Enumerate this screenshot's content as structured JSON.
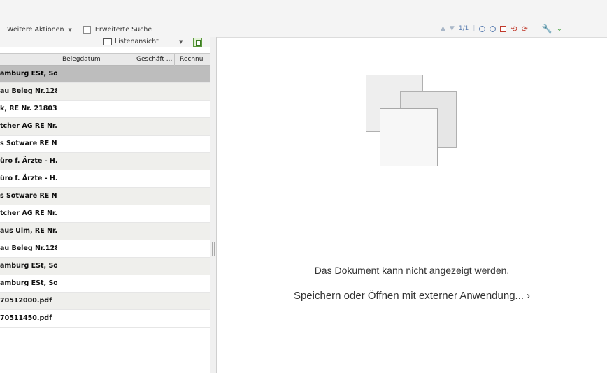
{
  "toolbar": {
    "more_actions_label": "Weitere Aktionen",
    "more_actions_icon": "chevron-down",
    "advanced_search_label": "Erweiterte Suche",
    "advanced_search_checked": false
  },
  "list_toolbar": {
    "view_label": "Listenansicht",
    "view_icon": "grid-list",
    "export_icon": "excel-export"
  },
  "table": {
    "columns": [
      "Belegdatum",
      "Geschäft ...",
      "Rechnu"
    ],
    "rows": [
      {
        "label": "amburg ESt, Soll",
        "state": "selected"
      },
      {
        "label": "au Beleg Nr.128",
        "state": "alt"
      },
      {
        "label": "k, RE Nr. 21803",
        "state": ""
      },
      {
        "label": "tcher AG RE Nr.",
        "state": "alt"
      },
      {
        "label": "s Sotware RE Nr",
        "state": ""
      },
      {
        "label": "üro f. Ärzte - H.",
        "state": "alt"
      },
      {
        "label": "üro f. Ärzte - H.",
        "state": ""
      },
      {
        "label": "s Sotware RE Nr",
        "state": "alt"
      },
      {
        "label": "tcher AG RE Nr.",
        "state": ""
      },
      {
        "label": "aus Ulm, RE Nr.",
        "state": "alt"
      },
      {
        "label": "au Beleg Nr.128",
        "state": ""
      },
      {
        "label": "amburg ESt, Soll",
        "state": "alt"
      },
      {
        "label": "amburg ESt, Soll",
        "state": ""
      },
      {
        "label": "70512000.pdf",
        "state": "alt"
      },
      {
        "label": "70511450.pdf",
        "state": ""
      }
    ]
  },
  "viewer": {
    "page_indicator": "1/1",
    "message": "Das Dokument kann nicht angezeigt werden.",
    "open_external": "Speichern oder Öffnen mit externer Anwendung...",
    "open_external_arrow": "›"
  },
  "colors": {
    "selected_row": "#bdbdbd",
    "alt_row": "#efefec",
    "accent_blue": "#5a7db0",
    "accent_green": "#3fa03a",
    "accent_red": "#c0392b"
  }
}
